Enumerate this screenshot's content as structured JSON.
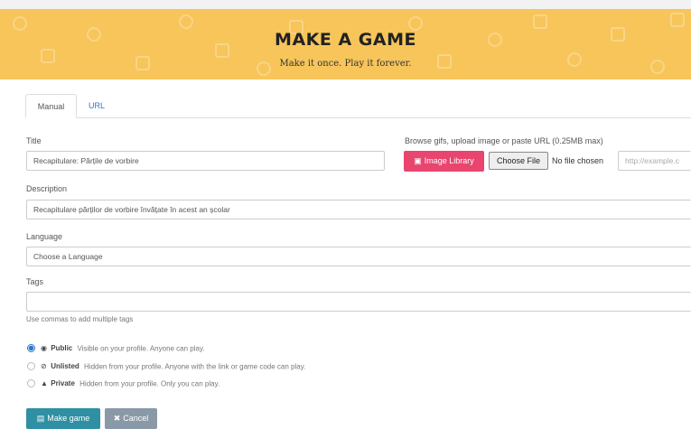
{
  "header": {
    "title": "MAKE A GAME",
    "subtitle": "Make it once. Play it forever.",
    "color": "#f7c55a"
  },
  "tabs": [
    {
      "label": "Manual",
      "active": true
    },
    {
      "label": "URL",
      "active": false
    }
  ],
  "form": {
    "title_label": "Title",
    "title_value": "Recapitulare: Părțile de vorbire",
    "image_label": "Browse gifs, upload image or paste URL (0.25MB max)",
    "image_library_label": "Image Library",
    "choose_file_label": "Choose File",
    "file_status": "No file chosen",
    "url_placeholder": "http://example.c",
    "description_label": "Description",
    "description_value": "Recapitulare părților de vorbire învățate în acest an școlar",
    "language_label": "Language",
    "language_value": "Choose a Language",
    "tags_label": "Tags",
    "tags_value": "",
    "tags_hint": "Use commas to add multiple tags"
  },
  "visibility": [
    {
      "name": "Public",
      "desc": "Visible on your profile. Anyone can play.",
      "icon": "eye-icon",
      "selected": true
    },
    {
      "name": "Unlisted",
      "desc": "Hidden from your profile. Anyone with the link or game code can play.",
      "icon": "eye-slash-icon",
      "selected": false
    },
    {
      "name": "Private",
      "desc": "Hidden from your profile. Only you can play.",
      "icon": "lock-icon",
      "selected": false
    }
  ],
  "actions": {
    "make_label": "Make game",
    "cancel_label": "Cancel",
    "make_color": "#2f8fa3",
    "cancel_color": "#8a99a8"
  },
  "accent": {
    "link": "#2a7ac7",
    "image_library": "#e8456f"
  }
}
